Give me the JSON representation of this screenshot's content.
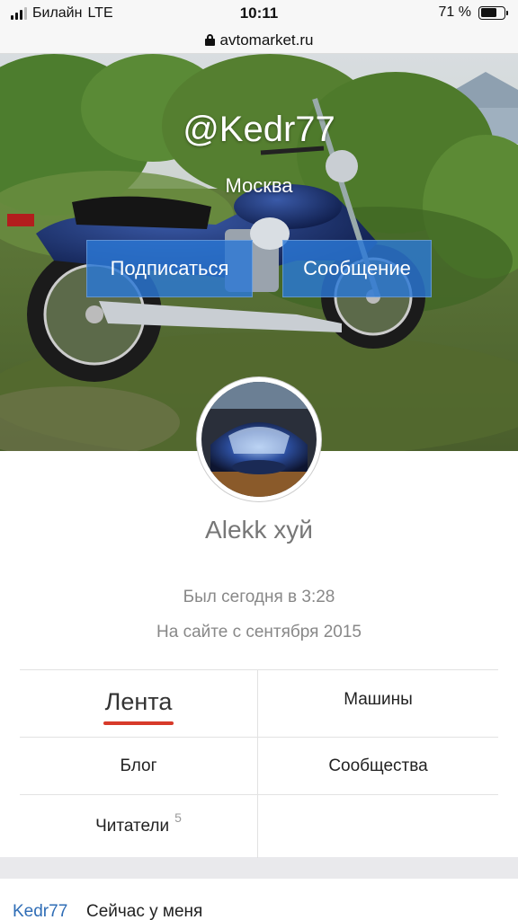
{
  "status_bar": {
    "carrier": "Билайн",
    "network": "LTE",
    "time": "10:11",
    "battery_text": "71 %",
    "battery_level_percent": 71
  },
  "browser": {
    "url": "avtomarket.ru"
  },
  "profile": {
    "username": "@Kedr77",
    "city": "Москва",
    "display_name": "Alekk хуй",
    "last_seen": "Был сегодня в 3:28",
    "member_since": "На сайте с сентября 2015"
  },
  "actions": {
    "subscribe_label": "Подписаться",
    "message_label": "Сообщение"
  },
  "tabs": {
    "feed": "Лента",
    "cars": "Машины",
    "blog": "Блог",
    "communities": "Сообщества",
    "readers": "Читатели",
    "readers_count": "5"
  },
  "post_preview": {
    "author": "Kedr77",
    "title": "Сейчас у меня"
  },
  "colors": {
    "accent_button": "#2b78d6",
    "active_tab_underline": "#d73a2a",
    "link": "#2f6db6"
  }
}
